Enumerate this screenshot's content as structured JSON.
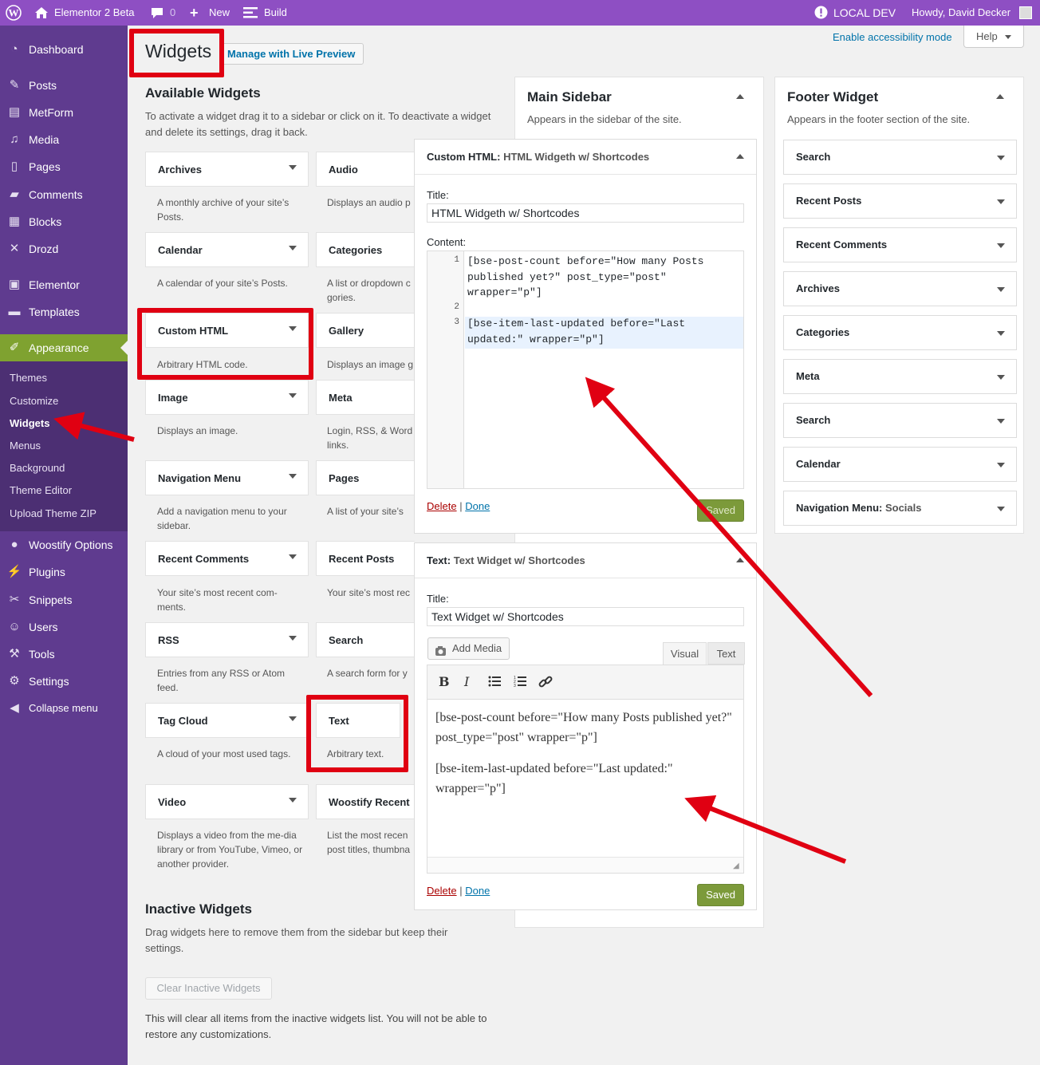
{
  "adminbar": {
    "site": "Elementor 2 Beta",
    "comments": "0",
    "new": "New",
    "build": "Build",
    "env": "LOCAL DEV",
    "greeting": "Howdy, David Decker"
  },
  "menu": {
    "dashboard": "Dashboard",
    "posts": "Posts",
    "metform": "MetForm",
    "media": "Media",
    "pages": "Pages",
    "comments": "Comments",
    "blocks": "Blocks",
    "drozd": "Drozd",
    "elementor": "Elementor",
    "templates": "Templates",
    "appearance": "Appearance",
    "sub": [
      "Themes",
      "Customize",
      "Widgets",
      "Menus",
      "Background",
      "Theme Editor",
      "Upload Theme ZIP"
    ],
    "woostify": "Woostify Options",
    "plugins": "Plugins",
    "snippets": "Snippets",
    "users": "Users",
    "tools": "Tools",
    "settings": "Settings",
    "collapse": "Collapse menu"
  },
  "header": {
    "accessibility": "Enable accessibility mode",
    "help": "Help",
    "title": "Widgets",
    "live_preview": "Manage with Live Preview"
  },
  "available": {
    "heading": "Available Widgets",
    "intro": "To activate a widget drag it to a sidebar or click on it. To deactivate a widget and delete its settings, drag it back.",
    "left": [
      {
        "name": "Archives",
        "desc": "A monthly archive of your site’s Posts."
      },
      {
        "name": "Calendar",
        "desc": "A calendar of your site’s Posts."
      },
      {
        "name": "Custom HTML",
        "desc": "Arbitrary HTML code."
      },
      {
        "name": "Image",
        "desc": "Displays an image."
      },
      {
        "name": "Navigation Menu",
        "desc": "Add a navigation menu to your sidebar."
      },
      {
        "name": "Recent Comments",
        "desc": "Your site’s most recent com-ments."
      },
      {
        "name": "RSS",
        "desc": "Entries from any RSS or Atom feed."
      },
      {
        "name": "Tag Cloud",
        "desc": "A cloud of your most used tags."
      },
      {
        "name": "Video",
        "desc": "Displays a video from the me-dia library or from YouTube, Vimeo, or another provider."
      }
    ],
    "right": [
      {
        "name": "Audio",
        "desc": "Displays an audio p"
      },
      {
        "name": "Categories",
        "desc": "A list or dropdown c gories."
      },
      {
        "name": "Gallery",
        "desc": "Displays an image g"
      },
      {
        "name": "Meta",
        "desc": "Login, RSS, & Word links."
      },
      {
        "name": "Pages",
        "desc": "A list of your site’s"
      },
      {
        "name": "Recent Posts",
        "desc": "Your site’s most rec"
      },
      {
        "name": "Search",
        "desc": "A search form for y"
      },
      {
        "name": "Text",
        "desc": "Arbitrary text."
      },
      {
        "name": "Woostify Recent",
        "desc": "List the most recen post titles, thumbna"
      }
    ]
  },
  "inactive": {
    "heading": "Inactive Widgets",
    "desc": "Drag widgets here to remove them from the sidebar but keep their settings.",
    "clear": "Clear Inactive Widgets",
    "note": "This will clear all items from the inactive widgets list. You will not be able to restore any customizations."
  },
  "main_sidebar": {
    "title": "Main Sidebar",
    "desc": "Appears in the sidebar of the site."
  },
  "html_widget": {
    "type": "Custom HTML:",
    "name": "HTML Widgeth w/ Shortcodes",
    "title_label": "Title:",
    "title_value": "HTML Widgeth w/ Shortcodes",
    "content_label": "Content:",
    "lines": [
      "1",
      "2",
      "3"
    ],
    "code1": "[bse-post-count before=\"How many Posts published yet?\" post_type=\"post\" wrapper=\"p\"]",
    "code3": "[bse-item-last-updated before=\"Last updated:\" wrapper=\"p\"]",
    "delete": "Delete",
    "sep": "|",
    "done": "Done",
    "saved": "Saved"
  },
  "text_widget": {
    "type": "Text:",
    "name": "Text Widget w/ Shortcodes",
    "title_label": "Title:",
    "title_value": "Text Widget w/ Shortcodes",
    "add_media": "Add Media",
    "visual": "Visual",
    "text": "Text",
    "para1": "[bse-post-count before=\"How many Posts published yet?\" post_type=\"post\" wrapper=\"p\"]",
    "para2": "[bse-item-last-updated before=\"Last updated:\" wrapper=\"p\"]",
    "delete": "Delete",
    "sep": "|",
    "done": "Done",
    "saved": "Saved"
  },
  "footer_widget": {
    "title": "Footer Widget",
    "desc": "Appears in the footer section of the site.",
    "items": [
      "Search",
      "Recent Posts",
      "Recent Comments",
      "Archives",
      "Categories",
      "Meta",
      "Search",
      "Calendar"
    ],
    "nav_prefix": "Navigation Menu:",
    "nav_name": "Socials"
  },
  "colors": {
    "adminbar": "#8e4fc3",
    "sidebar": "#5f3b8f",
    "active": "#7fa230",
    "highlight": "#e00012"
  }
}
